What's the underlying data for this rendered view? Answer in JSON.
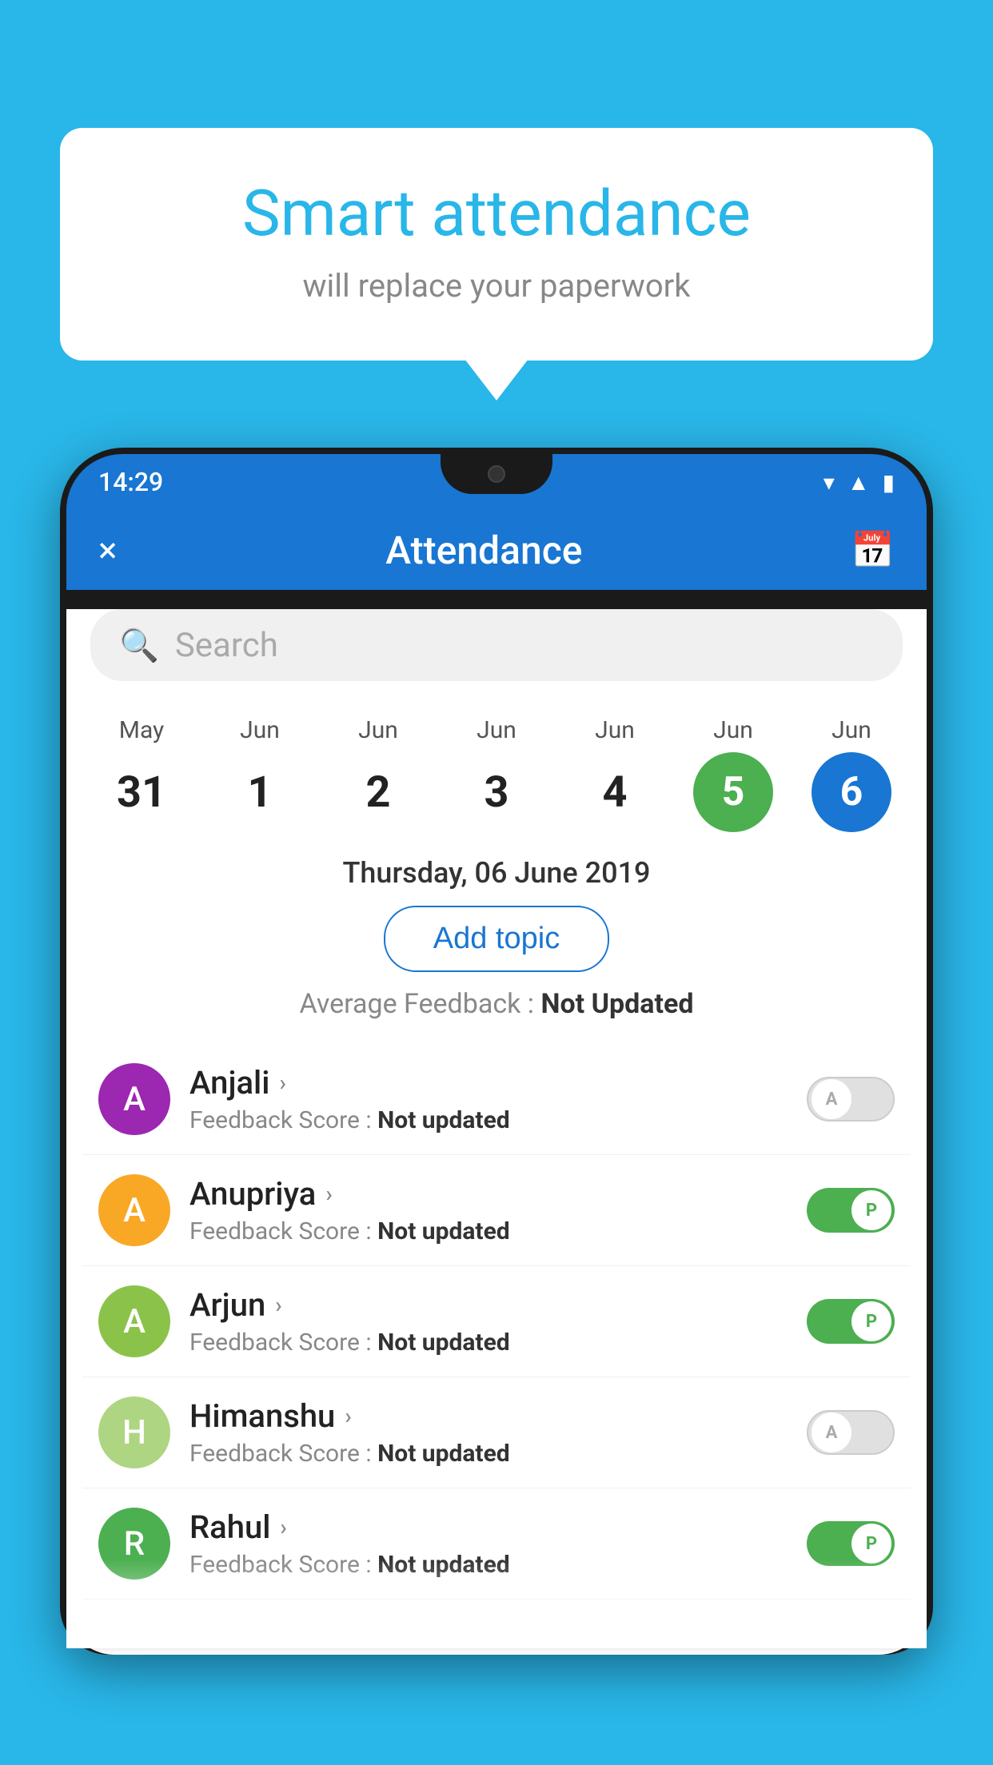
{
  "background_color": "#29b6e8",
  "speech_bubble": {
    "title": "Smart attendance",
    "subtitle": "will replace your paperwork"
  },
  "status_bar": {
    "time": "14:29",
    "icons": [
      "wifi",
      "signal",
      "battery"
    ]
  },
  "app_header": {
    "title": "Attendance",
    "close_label": "×",
    "calendar_icon": "📅"
  },
  "search": {
    "placeholder": "Search"
  },
  "calendar": {
    "days": [
      {
        "month": "May",
        "date": "31",
        "style": "normal"
      },
      {
        "month": "Jun",
        "date": "1",
        "style": "normal"
      },
      {
        "month": "Jun",
        "date": "2",
        "style": "normal"
      },
      {
        "month": "Jun",
        "date": "3",
        "style": "normal"
      },
      {
        "month": "Jun",
        "date": "4",
        "style": "normal"
      },
      {
        "month": "Jun",
        "date": "5",
        "style": "green"
      },
      {
        "month": "Jun",
        "date": "6",
        "style": "blue"
      }
    ]
  },
  "selected_date": "Thursday, 06 June 2019",
  "add_topic_label": "Add topic",
  "avg_feedback_label": "Average Feedback : ",
  "avg_feedback_value": "Not Updated",
  "students": [
    {
      "name": "Anjali",
      "avatar_letter": "A",
      "avatar_color": "#9c27b0",
      "feedback_label": "Feedback Score : ",
      "feedback_value": "Not updated",
      "toggle_state": "off",
      "toggle_label": "A"
    },
    {
      "name": "Anupriya",
      "avatar_letter": "A",
      "avatar_color": "#f9a825",
      "feedback_label": "Feedback Score : ",
      "feedback_value": "Not updated",
      "toggle_state": "on",
      "toggle_label": "P"
    },
    {
      "name": "Arjun",
      "avatar_letter": "A",
      "avatar_color": "#8bc34a",
      "feedback_label": "Feedback Score : ",
      "feedback_value": "Not updated",
      "toggle_state": "on",
      "toggle_label": "P"
    },
    {
      "name": "Himanshu",
      "avatar_letter": "H",
      "avatar_color": "#aed581",
      "feedback_label": "Feedback Score : ",
      "feedback_value": "Not updated",
      "toggle_state": "off",
      "toggle_label": "A"
    },
    {
      "name": "Rahul",
      "avatar_letter": "R",
      "avatar_color": "#4caf50",
      "feedback_label": "Feedback Score : ",
      "feedback_value": "Not updated",
      "toggle_state": "on",
      "toggle_label": "P"
    }
  ]
}
